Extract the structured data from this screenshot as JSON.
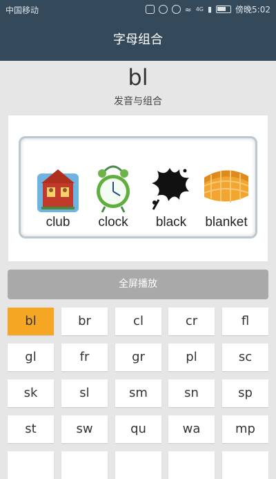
{
  "status": {
    "carrier": "中国移动",
    "network": "4G",
    "time_label": "傍晚5:02"
  },
  "header": {
    "title": "字母组合"
  },
  "combo": {
    "letters": "bl",
    "subtitle": "发音与组合"
  },
  "examples": [
    {
      "word": "club",
      "icon": "schoolhouse-icon"
    },
    {
      "word": "clock",
      "icon": "alarm-clock-icon"
    },
    {
      "word": "black",
      "icon": "black-splat-icon"
    },
    {
      "word": "blanket",
      "icon": "blanket-icon"
    }
  ],
  "play_button": {
    "label": "全屏播放"
  },
  "grid": {
    "selected": "bl",
    "active_color": "#f5a623",
    "rows": [
      [
        "bl",
        "br",
        "cl",
        "cr",
        "fl"
      ],
      [
        "gl",
        "fr",
        "gr",
        "pl",
        "sc"
      ],
      [
        "sk",
        "sl",
        "sm",
        "sn",
        "sp"
      ],
      [
        "st",
        "sw",
        "qu",
        "wa",
        "mp"
      ],
      [
        "",
        "",
        "",
        "",
        ""
      ]
    ]
  }
}
